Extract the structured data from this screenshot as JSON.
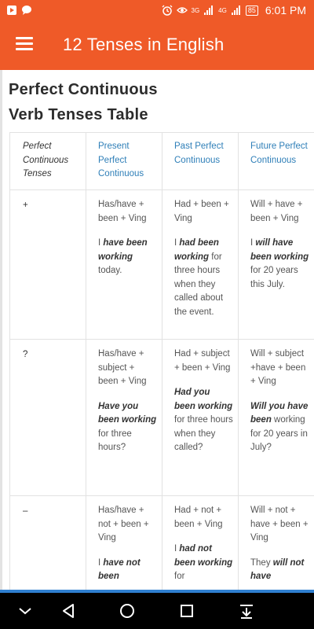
{
  "status_bar": {
    "time": "6:01 PM",
    "battery": "85",
    "signal_tag_1": "3G",
    "signal_tag_2": "4G",
    "icons": [
      "notification-icon",
      "chat-icon",
      "alarm-icon",
      "eye-icon",
      "signal-icon",
      "battery-icon"
    ]
  },
  "app_bar": {
    "title": "12 Tenses in English",
    "menu_icon": "hamburger-menu-icon"
  },
  "page": {
    "title_line1": "Perfect Continuous",
    "title_line2": "Verb Tenses Table"
  },
  "table": {
    "headers": [
      "Perfect Continuous Tenses",
      "Present Perfect Continuous",
      "Past Perfect Continuous",
      "Future Perfect Continuous"
    ],
    "rows": [
      {
        "sign": "+",
        "present_formula": "Has/have + been + Ving",
        "present_ex_pre": "I ",
        "present_ex_bold": "have been working",
        "present_ex_post": " today.",
        "past_formula": "Had + been + Ving",
        "past_ex_pre": "I ",
        "past_ex_bold": "had been working",
        "past_ex_post": " for three hours when they called about the event.",
        "future_formula": "Will + have + been + Ving",
        "future_ex_pre": "I ",
        "future_ex_bold": "will have been working",
        "future_ex_post": " for 20 years this July."
      },
      {
        "sign": "?",
        "present_formula": "Has/have + subject + been + Ving",
        "present_ex_pre": "",
        "present_ex_bold": "Have you been working",
        "present_ex_post": " for three hours?",
        "past_formula": "Had + subject + been + Ving",
        "past_ex_pre": "",
        "past_ex_bold": "Had you been working",
        "past_ex_post": " for three hours when they called?",
        "future_formula": "Will + subject +have + been + Ving",
        "future_ex_pre": "",
        "future_ex_bold": "Will you have been",
        "future_ex_post": " working for 20 years in July?"
      },
      {
        "sign": "–",
        "present_formula": "Has/have + not + been + Ving",
        "present_ex_pre": "I ",
        "present_ex_bold": "have not been",
        "present_ex_post": "",
        "past_formula": "Had + not + been + Ving",
        "past_ex_pre": "I ",
        "past_ex_bold": "had not been working",
        "past_ex_post": " for",
        "future_formula": "Will + not + have + been + Ving",
        "future_ex_pre": "They ",
        "future_ex_bold": "will not have",
        "future_ex_post": ""
      }
    ]
  },
  "nav_bar": {
    "icons": [
      "collapse-down-icon",
      "back-icon",
      "home-icon",
      "recents-icon",
      "download-icon"
    ]
  },
  "colors": {
    "accent": "#ef5a28",
    "header_blue": "#2f7fb8",
    "scroll_indicator": "#2f7fd0"
  }
}
